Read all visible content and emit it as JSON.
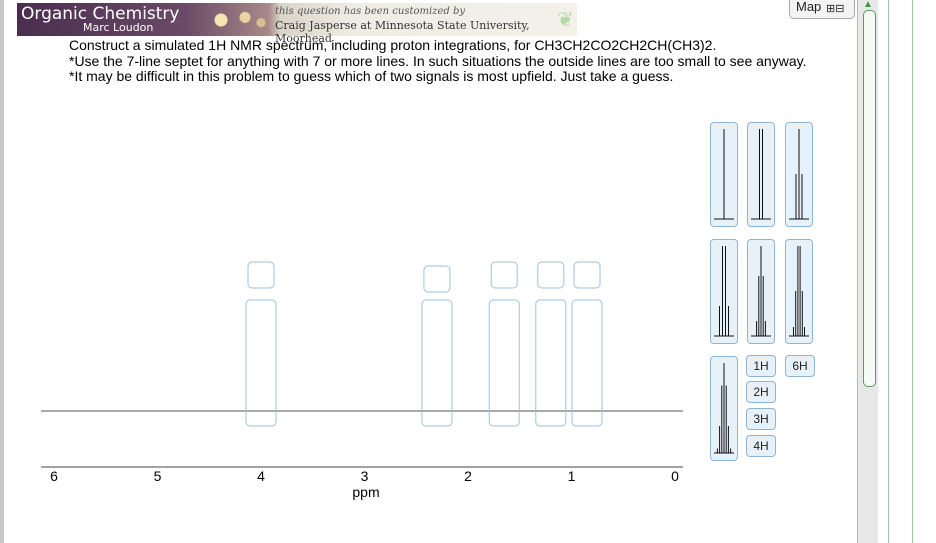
{
  "banner": {
    "title": "Organic Chemistry",
    "author": "Marc Loudon",
    "custom_line1": "this question has been customized by",
    "custom_line2": "Craig Jasperse at Minnesota State University, Moorhead"
  },
  "map_button": {
    "label": "Map",
    "icon": "map-icon"
  },
  "question": {
    "line1": "Construct a simulated 1H NMR spectrum, including proton integrations, for CH3CH2CO2CH2CH(CH3)2.",
    "line2": "*Use the 7-line septet for anything with 7 or more lines.  In such situations the outside lines are too small to see anyway.",
    "line3": "*It may be difficult in this problem to guess which of two signals is most upfield.  Just take a guess."
  },
  "axis": {
    "label": "ppm",
    "ticks": [
      "6",
      "5",
      "4",
      "3",
      "2",
      "1",
      "0"
    ]
  },
  "drop_targets": [
    {
      "ppm": 4.0
    },
    {
      "ppm": 2.3
    },
    {
      "ppm": 1.65
    },
    {
      "ppm": 1.2
    },
    {
      "ppm": 0.85
    }
  ],
  "multiplet_palette": [
    {
      "name": "singlet",
      "lines": 1
    },
    {
      "name": "doublet",
      "lines": 2
    },
    {
      "name": "triplet",
      "lines": 3
    },
    {
      "name": "quartet",
      "lines": 4
    },
    {
      "name": "quintet",
      "lines": 5
    },
    {
      "name": "sextet",
      "lines": 6
    },
    {
      "name": "septet",
      "lines": 7
    }
  ],
  "integration_buttons": [
    "1H",
    "2H",
    "3H",
    "4H",
    "6H"
  ],
  "colors": {
    "accent": "#8fb5d3",
    "card_fill": "#e6f1f9",
    "scroll_green": "#5a9a5a"
  }
}
